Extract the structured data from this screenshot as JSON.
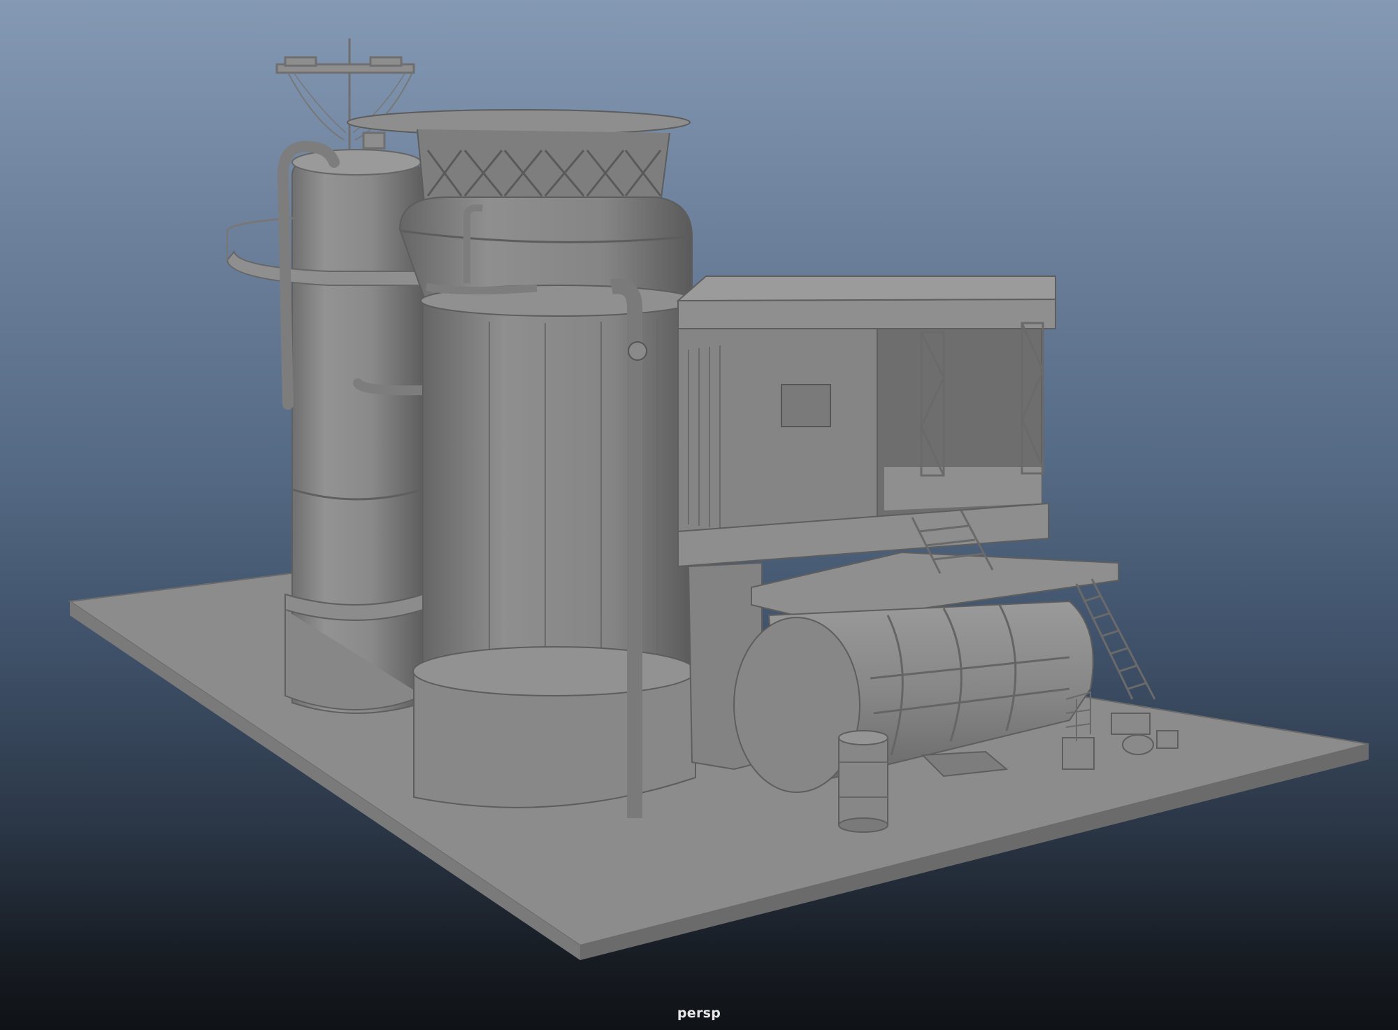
{
  "viewport": {
    "camera_label": "persp"
  },
  "scene": {
    "description_objects": [
      "ground-plane",
      "rear-silo",
      "front-silo",
      "cabin-building",
      "horizontal-tank",
      "barrel",
      "ladder",
      "antenna-mast"
    ]
  },
  "colors": {
    "background_top": "#8499b3",
    "background_bottom": "#0f1216",
    "model_gray": "#8a8a8a"
  }
}
